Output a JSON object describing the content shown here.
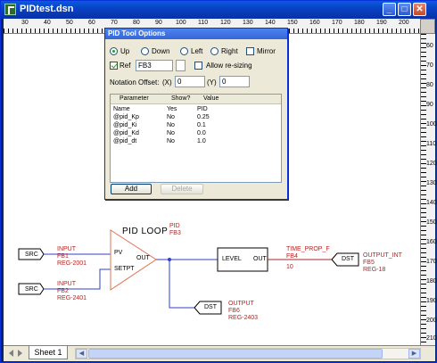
{
  "window": {
    "title": "PIDtest.dsn"
  },
  "ruler": {
    "top_labels": [
      "30",
      "40",
      "50",
      "60",
      "70",
      "80",
      "90",
      "100",
      "110",
      "120",
      "130",
      "140",
      "150",
      "160",
      "170",
      "180",
      "190",
      "200"
    ],
    "right_labels": [
      "60",
      "70",
      "80",
      "90",
      "100",
      "110",
      "120",
      "130",
      "140",
      "150",
      "160",
      "170",
      "180",
      "190",
      "200",
      "210"
    ]
  },
  "dialog": {
    "title": "PID Tool Options",
    "orientation": {
      "up": "Up",
      "down": "Down",
      "left": "Left",
      "right": "Right",
      "mirror": "Mirror",
      "selected": "Up"
    },
    "ref_label": "Ref",
    "ref_value": "FB3",
    "allow_resize": "Allow re-sizing",
    "notation_offset_label": "Notation Offset:",
    "x_label": "(X)",
    "x_value": "0",
    "y_label": "(Y)",
    "y_value": "0",
    "columns": [
      "Parameter",
      "Show?",
      "Value"
    ],
    "rows": [
      {
        "parameter": "Name",
        "show": "Yes",
        "value": "PID"
      },
      {
        "parameter": "@pid_Kp",
        "show": "No",
        "value": "0.25"
      },
      {
        "parameter": "@pid_Ki",
        "show": "No",
        "value": "0.1"
      },
      {
        "parameter": "@pid_Kd",
        "show": "No",
        "value": "0.0"
      },
      {
        "parameter": "@pid_dt",
        "show": "No",
        "value": "1.0"
      }
    ],
    "add_label": "Add",
    "delete_label": "Delete"
  },
  "diagram": {
    "pid_loop_label": "PID LOOP",
    "pid_name": "PID",
    "pid_ref": "FB3",
    "pid_pv": "PV",
    "pid_setpt": "SETPT",
    "pid_out": "OUT",
    "src1": {
      "block": "SRC",
      "name": "INPUT",
      "ref": "FB1",
      "addr": "REG-2001"
    },
    "src2": {
      "block": "SRC",
      "name": "INPUT",
      "ref": "FB2",
      "addr": "REG-2401"
    },
    "level": {
      "in": "LEVEL",
      "out": "OUT"
    },
    "time_prop": {
      "name": "TIME_PROP_F",
      "ref": "FB4",
      "value": "10"
    },
    "dst1": {
      "block": "DST",
      "name": "OUTPUT_INT",
      "ref": "FB5",
      "addr": "REG-18"
    },
    "dst2": {
      "block": "DST",
      "name": "OUTPUT",
      "ref": "FB6",
      "addr": "REG-2403"
    }
  },
  "sheet_tab": "Sheet 1",
  "colors": {
    "wire": "#3040C8",
    "label": "#B22222",
    "title_bar": "#0A5AE0"
  }
}
